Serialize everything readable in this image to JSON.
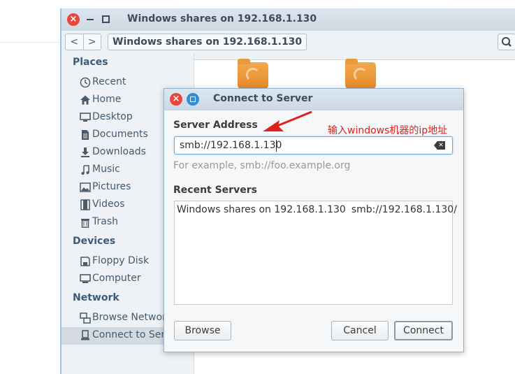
{
  "nautilus": {
    "title": "Windows shares on 192.168.1.130",
    "breadcrumb": "Windows shares on 192.168.1.130",
    "nav_back": "<",
    "nav_forward": ">",
    "sidebar": {
      "places_header": "Places",
      "places": [
        {
          "label": "Recent",
          "icon": "clock-icon"
        },
        {
          "label": "Home",
          "icon": "home-icon"
        },
        {
          "label": "Desktop",
          "icon": "desktop-icon"
        },
        {
          "label": "Documents",
          "icon": "document-icon"
        },
        {
          "label": "Downloads",
          "icon": "download-icon"
        },
        {
          "label": "Music",
          "icon": "music-icon"
        },
        {
          "label": "Pictures",
          "icon": "picture-icon"
        },
        {
          "label": "Videos",
          "icon": "video-icon"
        },
        {
          "label": "Trash",
          "icon": "trash-icon"
        }
      ],
      "devices_header": "Devices",
      "devices": [
        {
          "label": "Floppy Disk",
          "icon": "floppy-icon"
        },
        {
          "label": "Computer",
          "icon": "computer-icon"
        }
      ],
      "network_header": "Network",
      "network": [
        {
          "label": "Browse Network",
          "icon": "network-icon"
        },
        {
          "label": "Connect to Server",
          "icon": "server-icon"
        }
      ]
    }
  },
  "dialog": {
    "title": "Connect to Server",
    "server_address_label": "Server Address",
    "server_address_value": "smb://192.168.1.130",
    "example_hint": "For example, smb://foo.example.org",
    "recent_servers_label": "Recent Servers",
    "recent_servers": [
      {
        "name": "Windows shares on 192.168.1.130",
        "url": "smb://192.168.1.130/"
      }
    ],
    "browse_button": "Browse",
    "cancel_button": "Cancel",
    "connect_button": "Connect"
  },
  "annotation": {
    "text": "输入windows机器的ip地址",
    "color": "#e0201a"
  }
}
